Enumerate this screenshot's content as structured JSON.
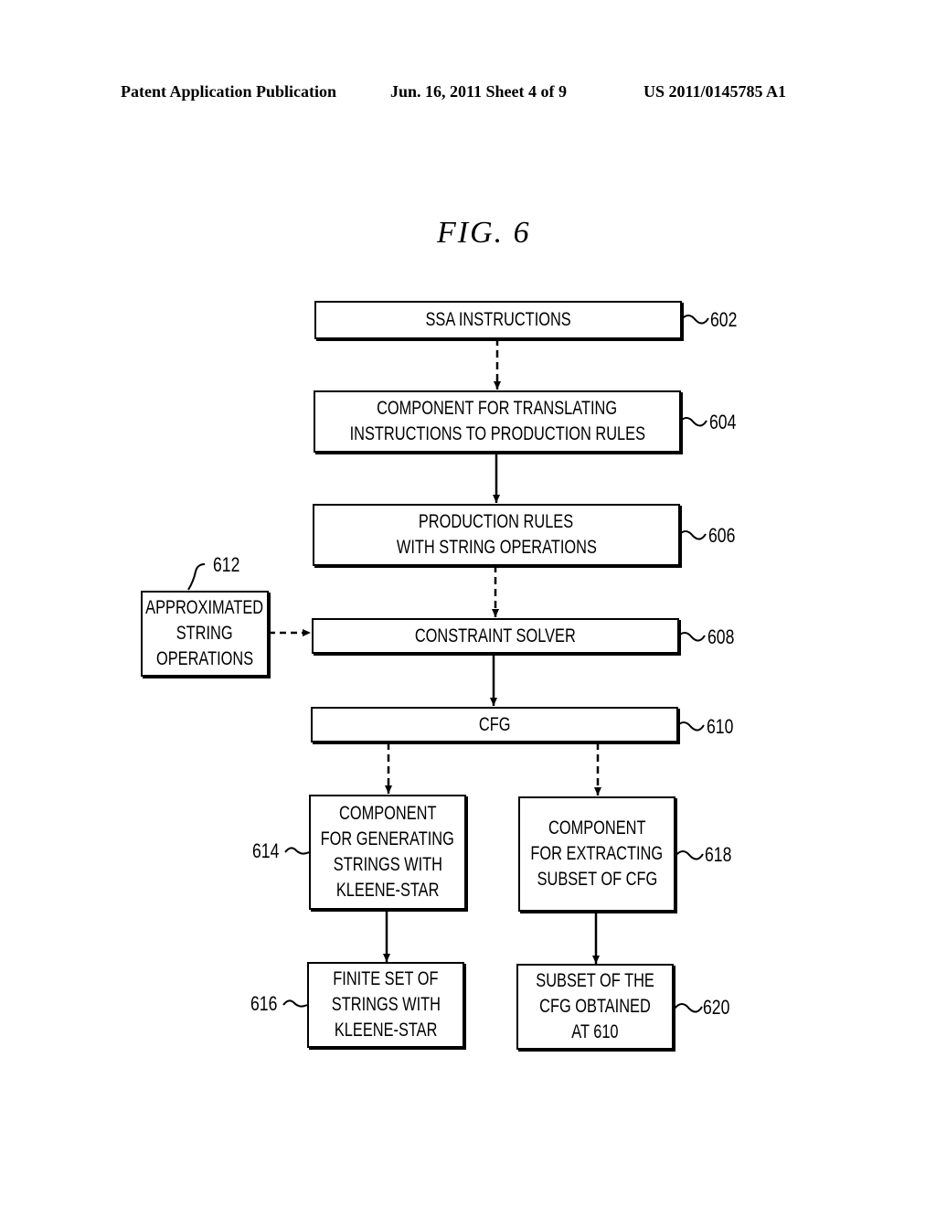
{
  "header": {
    "publication": "Patent Application Publication",
    "date_sheet": "Jun. 16, 2011  Sheet 4 of 9",
    "number": "US 2011/0145785 A1"
  },
  "figure": {
    "title": "FIG.  6"
  },
  "nodes": {
    "n602": {
      "ref": "602",
      "lines": [
        "SSA INSTRUCTIONS"
      ]
    },
    "n604": {
      "ref": "604",
      "lines": [
        "COMPONENT FOR TRANSLATING",
        "INSTRUCTIONS TO PRODUCTION RULES"
      ]
    },
    "n606": {
      "ref": "606",
      "lines": [
        "PRODUCTION RULES",
        "WITH STRING OPERATIONS"
      ]
    },
    "n608": {
      "ref": "608",
      "lines": [
        "CONSTRAINT SOLVER"
      ]
    },
    "n610": {
      "ref": "610",
      "lines": [
        "CFG"
      ]
    },
    "n612": {
      "ref": "612",
      "lines": [
        "APPROXIMATED",
        "STRING",
        "OPERATIONS"
      ]
    },
    "n614": {
      "ref": "614",
      "lines": [
        "COMPONENT",
        "FOR GENERATING",
        "STRINGS WITH",
        "KLEENE-STAR"
      ]
    },
    "n616": {
      "ref": "616",
      "lines": [
        "FINITE SET OF",
        "STRINGS WITH",
        "KLEENE-STAR"
      ]
    },
    "n618": {
      "ref": "618",
      "lines": [
        "COMPONENT",
        "FOR EXTRACTING",
        "SUBSET OF CFG"
      ]
    },
    "n620": {
      "ref": "620",
      "lines": [
        "SUBSET OF THE",
        "CFG OBTAINED",
        "AT 610"
      ]
    }
  },
  "edges": [
    {
      "from": "602",
      "to": "604",
      "style": "dashed"
    },
    {
      "from": "604",
      "to": "606",
      "style": "solid"
    },
    {
      "from": "606",
      "to": "608",
      "style": "dashed"
    },
    {
      "from": "612",
      "to": "608",
      "style": "dashed"
    },
    {
      "from": "608",
      "to": "610",
      "style": "solid"
    },
    {
      "from": "610",
      "to": "614",
      "style": "dashed"
    },
    {
      "from": "610",
      "to": "618",
      "style": "dashed"
    },
    {
      "from": "614",
      "to": "616",
      "style": "solid"
    },
    {
      "from": "618",
      "to": "620",
      "style": "solid"
    }
  ]
}
